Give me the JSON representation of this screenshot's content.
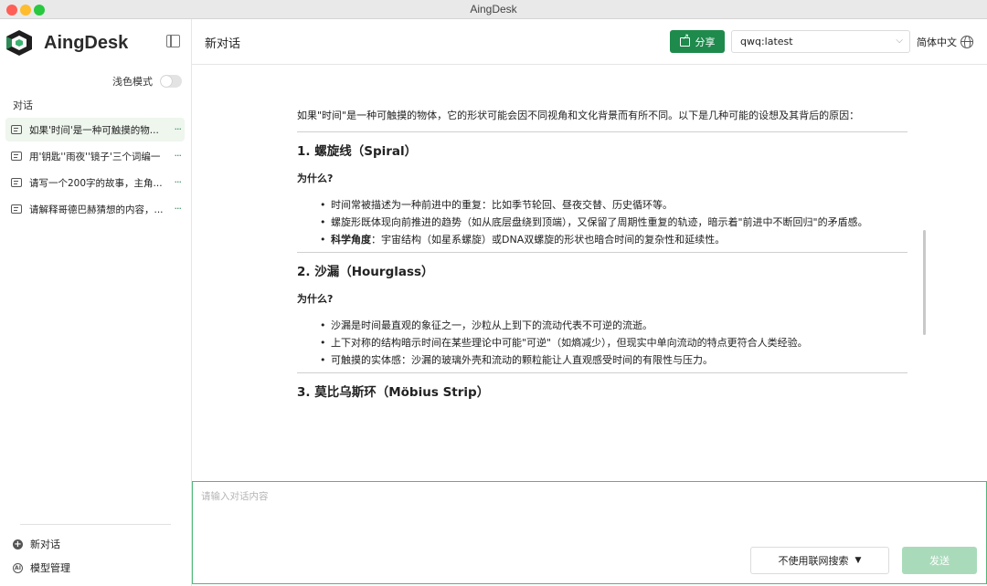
{
  "window": {
    "title": "AingDesk"
  },
  "sidebar": {
    "brand": "AingDesk",
    "theme_label": "浅色模式",
    "section_label": "对话",
    "conversations": [
      {
        "title": "如果'时间'是一种可触摸的物..."
      },
      {
        "title": "用'钥匙''雨夜''镜子'三个词编一"
      },
      {
        "title": "请写一个200字的故事，主角..."
      },
      {
        "title": "请解释哥德巴赫猜想的内容，..."
      }
    ],
    "more_glyph": "···",
    "new_chat": "新对话",
    "model_manage": "模型管理"
  },
  "header": {
    "title": "新对话",
    "share_label": "分享",
    "model_value": "qwq:latest",
    "language": "简体中文"
  },
  "article": {
    "intro": "如果\"时间\"是一种可触摸的物体，它的形状可能会因不同视角和文化背景而有所不同。以下是几种可能的设想及其背后的原因：",
    "sections": [
      {
        "heading": "1. 螺旋线（Spiral）",
        "why": "为什么?",
        "bullets": [
          {
            "prefix": "",
            "text": "时间常被描述为一种前进中的重复：比如季节轮回、昼夜交替、历史循环等。"
          },
          {
            "prefix": "",
            "text": "螺旋形既体现向前推进的趋势（如从底层盘绕到顶端），又保留了周期性重复的轨迹，暗示着\"前进中不断回归\"的矛盾感。"
          },
          {
            "prefix": "科学角度",
            "text": "：宇宙结构（如星系螺旋）或DNA双螺旋的形状也暗合时间的复杂性和延续性。"
          }
        ]
      },
      {
        "heading": "2. 沙漏（Hourglass）",
        "why": "为什么?",
        "bullets": [
          {
            "prefix": "",
            "text": "沙漏是时间最直观的象征之一，沙粒从上到下的流动代表不可逆的流逝。"
          },
          {
            "prefix": "",
            "text": "上下对称的结构暗示时间在某些理论中可能\"可逆\"（如熵减少），但现实中单向流动的特点更符合人类经验。"
          },
          {
            "prefix": "",
            "text": "可触摸的实体感：沙漏的玻璃外壳和流动的颗粒能让人直观感受时间的有限性与压力。"
          }
        ]
      },
      {
        "heading": "3. 莫比乌斯环（Möbius Strip）"
      }
    ]
  },
  "input": {
    "placeholder": "请输入对话内容",
    "web_search_label": "不使用联网搜索",
    "send_label": "发送"
  },
  "colors": {
    "accent": "#1e8a4c",
    "send_disabled": "#a9dbbb",
    "active_item_bg": "#eef6ee"
  }
}
